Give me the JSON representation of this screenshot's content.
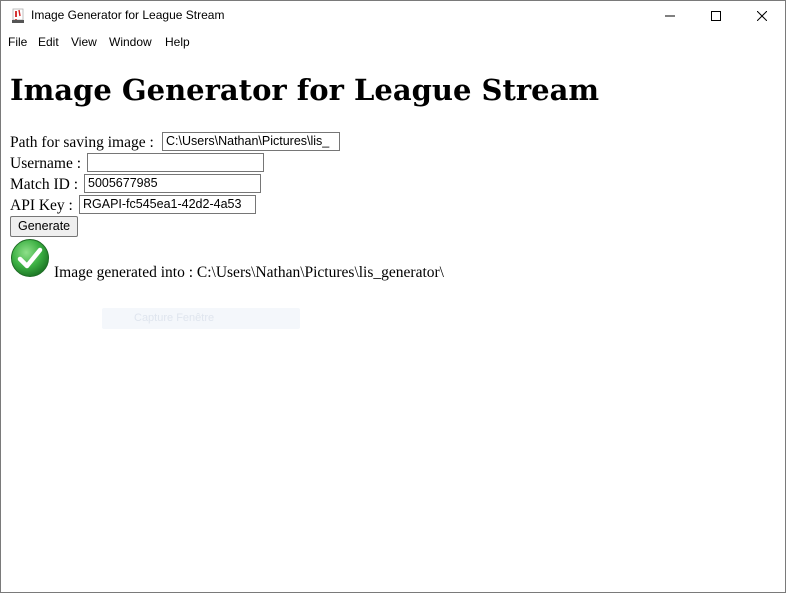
{
  "window": {
    "title": "Image Generator for League Stream"
  },
  "menu": {
    "file": "File",
    "edit": "Edit",
    "view": "View",
    "window": "Window",
    "help": "Help"
  },
  "main": {
    "heading": "Image Generator for League Stream",
    "path": {
      "label": "Path for saving image :",
      "value": "C:\\Users\\Nathan\\Pictures\\lis_"
    },
    "username": {
      "label": "Username :",
      "value": ""
    },
    "match_id": {
      "label": "Match ID :",
      "value": "5005677985"
    },
    "api_key": {
      "label": "API Key :",
      "value": "RGAPI-fc545ea1-42d2-4a53"
    },
    "generate_label": "Generate",
    "status_text": "Image generated into : C:\\Users\\Nathan\\Pictures\\lis_generator\\"
  },
  "overlay": {
    "label": "Capture Fenêtre"
  },
  "icons": {
    "app": "app-icon",
    "success": "check-circle-icon",
    "minimize": "minimize-icon",
    "maximize": "maximize-icon",
    "close": "close-icon"
  },
  "colors": {
    "success_green": "#3cb043"
  }
}
